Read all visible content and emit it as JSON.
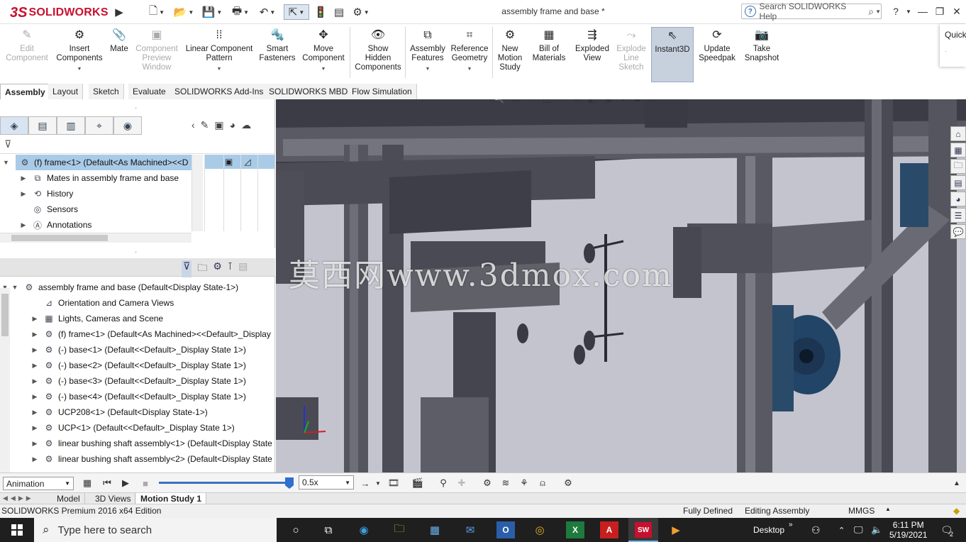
{
  "app": {
    "brand_prefix": "3S",
    "brand": "SOLIDWORKS",
    "document_title": "assembly frame and base *",
    "search_placeholder": "Search SOLIDWORKS Help",
    "help": "?",
    "quick_panel_label": "Quick"
  },
  "ribbon": {
    "buttons": [
      {
        "label1": "Edit",
        "label2": "Component",
        "label3": "",
        "icon": "edit-component-icon",
        "disabled": true
      },
      {
        "label1": "Insert",
        "label2": "Components",
        "label3": "",
        "icon": "insert-components-icon",
        "disabled": false
      },
      {
        "label1": "Mate",
        "label2": "",
        "label3": "",
        "icon": "mate-icon",
        "disabled": false
      },
      {
        "label1": "Component",
        "label2": "Preview",
        "label3": "Window",
        "icon": "component-preview-icon",
        "disabled": true
      },
      {
        "label1": "Linear Component",
        "label2": "Pattern",
        "label3": "",
        "icon": "linear-pattern-icon",
        "disabled": false
      },
      {
        "label1": "Smart",
        "label2": "Fasteners",
        "label3": "",
        "icon": "smart-fasteners-icon",
        "disabled": false
      },
      {
        "label1": "Move",
        "label2": "Component",
        "label3": "",
        "icon": "move-component-icon",
        "disabled": false
      },
      {
        "label1": "Show",
        "label2": "Hidden",
        "label3": "Components",
        "icon": "show-hidden-icon",
        "disabled": false
      },
      {
        "label1": "Assembly",
        "label2": "Features",
        "label3": "",
        "icon": "assembly-features-icon",
        "disabled": false
      },
      {
        "label1": "Reference",
        "label2": "Geometry",
        "label3": "",
        "icon": "reference-geometry-icon",
        "disabled": false
      },
      {
        "label1": "New",
        "label2": "Motion",
        "label3": "Study",
        "icon": "motion-study-icon",
        "disabled": false
      },
      {
        "label1": "Bill of",
        "label2": "Materials",
        "label3": "",
        "icon": "bom-icon",
        "disabled": false
      },
      {
        "label1": "Exploded",
        "label2": "View",
        "label3": "",
        "icon": "exploded-view-icon",
        "disabled": false
      },
      {
        "label1": "Explode",
        "label2": "Line",
        "label3": "Sketch",
        "icon": "explode-line-icon",
        "disabled": true
      },
      {
        "label1": "Instant3D",
        "label2": "",
        "label3": "",
        "icon": "instant3d-icon",
        "disabled": false
      },
      {
        "label1": "Update",
        "label2": "Speedpak",
        "label3": "",
        "icon": "speedpak-icon",
        "disabled": false
      },
      {
        "label1": "Take",
        "label2": "Snapshot",
        "label3": "",
        "icon": "snapshot-icon",
        "disabled": false
      }
    ]
  },
  "tabs": [
    "Assembly",
    "Layout",
    "Sketch",
    "Evaluate",
    "SOLIDWORKS Add-Ins",
    "SOLIDWORKS MBD",
    "Flow Simulation"
  ],
  "top_tree": {
    "selected": "(f) frame<1> (Default<As Machined><<D",
    "items": [
      "Mates in assembly frame and base",
      "History",
      "Sensors",
      "Annotations"
    ]
  },
  "feature_tree": {
    "root": "assembly frame and base  (Default<Display State-1>)",
    "items": [
      {
        "label": "Orientation and Camera Views",
        "expand": false
      },
      {
        "label": "Lights, Cameras and Scene",
        "expand": true
      },
      {
        "label": "(f) frame<1> (Default<As Machined><<Default>_Display",
        "expand": true
      },
      {
        "label": "(-) base<1> (Default<<Default>_Display State 1>)",
        "expand": true
      },
      {
        "label": "(-) base<2> (Default<<Default>_Display State 1>)",
        "expand": true
      },
      {
        "label": "(-) base<3> (Default<<Default>_Display State 1>)",
        "expand": true
      },
      {
        "label": "(-) base<4> (Default<<Default>_Display State 1>)",
        "expand": true
      },
      {
        "label": "UCP208<1> (Default<Display State-1>)",
        "expand": true
      },
      {
        "label": "UCP<1> (Default<<Default>_Display State 1>)",
        "expand": true
      },
      {
        "label": "linear bushing shaft assembly<1> (Default<Display State",
        "expand": true
      },
      {
        "label": "linear bushing shaft assembly<2> (Default<Display State",
        "expand": true
      }
    ]
  },
  "viewport": {
    "watermark": "莫西网www.3dmox.com"
  },
  "motion": {
    "study_type": "Animation",
    "speed": "0.5x",
    "playback_progress": 1.0
  },
  "bottom_tabs": [
    "Model",
    "3D Views",
    "Motion Study 1"
  ],
  "status": {
    "edition": "SOLIDWORKS Premium 2016 x64 Edition",
    "defined": "Fully Defined",
    "editing": "Editing Assembly",
    "units": "MMGS"
  },
  "taskbar": {
    "search_placeholder": "Type here to search",
    "desktop": "Desktop",
    "time": "6:11 PM",
    "date": "5/19/2021",
    "notifications": "2"
  }
}
